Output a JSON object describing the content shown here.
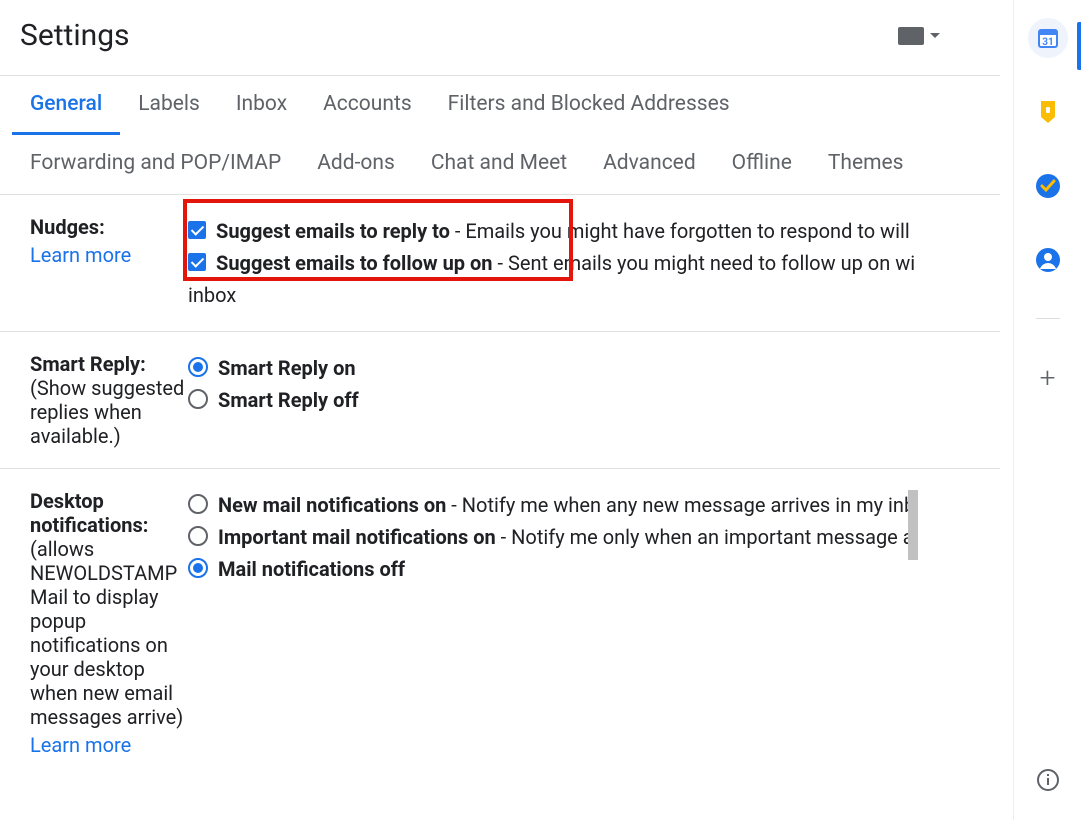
{
  "header": {
    "title": "Settings"
  },
  "tabs": {
    "row1": [
      "General",
      "Labels",
      "Inbox",
      "Accounts",
      "Filters and Blocked Addresses"
    ],
    "row2": [
      "Forwarding and POP/IMAP",
      "Add-ons",
      "Chat and Meet",
      "Advanced",
      "Offline",
      "Themes"
    ],
    "active": "General"
  },
  "nudges": {
    "title": "Nudges:",
    "learn_more": "Learn more",
    "opt1_label": "Suggest emails to reply to",
    "opt1_desc": " - Emails you might have forgotten to respond to will",
    "opt2_label": "Suggest emails to follow up on",
    "opt2_desc": " - Sent emails you might need to follow up on wi",
    "inbox_trail": "inbox"
  },
  "smart_reply": {
    "title": "Smart Reply:",
    "desc": "(Show suggested replies when available.)",
    "opt_on": "Smart Reply on",
    "opt_off": "Smart Reply off"
  },
  "desktop_notifications": {
    "title": "Desktop notifications:",
    "desc": "(allows NEWOLDSTAMP Mail to display popup notifications on your desktop when new email messages arrive)",
    "learn_more": "Learn more",
    "opt1_label": "New mail notifications on",
    "opt1_desc": " - Notify me when any new message arrives in my inb",
    "opt2_label": "Important mail notifications on",
    "opt2_desc": " - Notify me only when an important message a",
    "opt3_label": "Mail notifications off"
  },
  "side": {
    "calendar_day": "31"
  }
}
